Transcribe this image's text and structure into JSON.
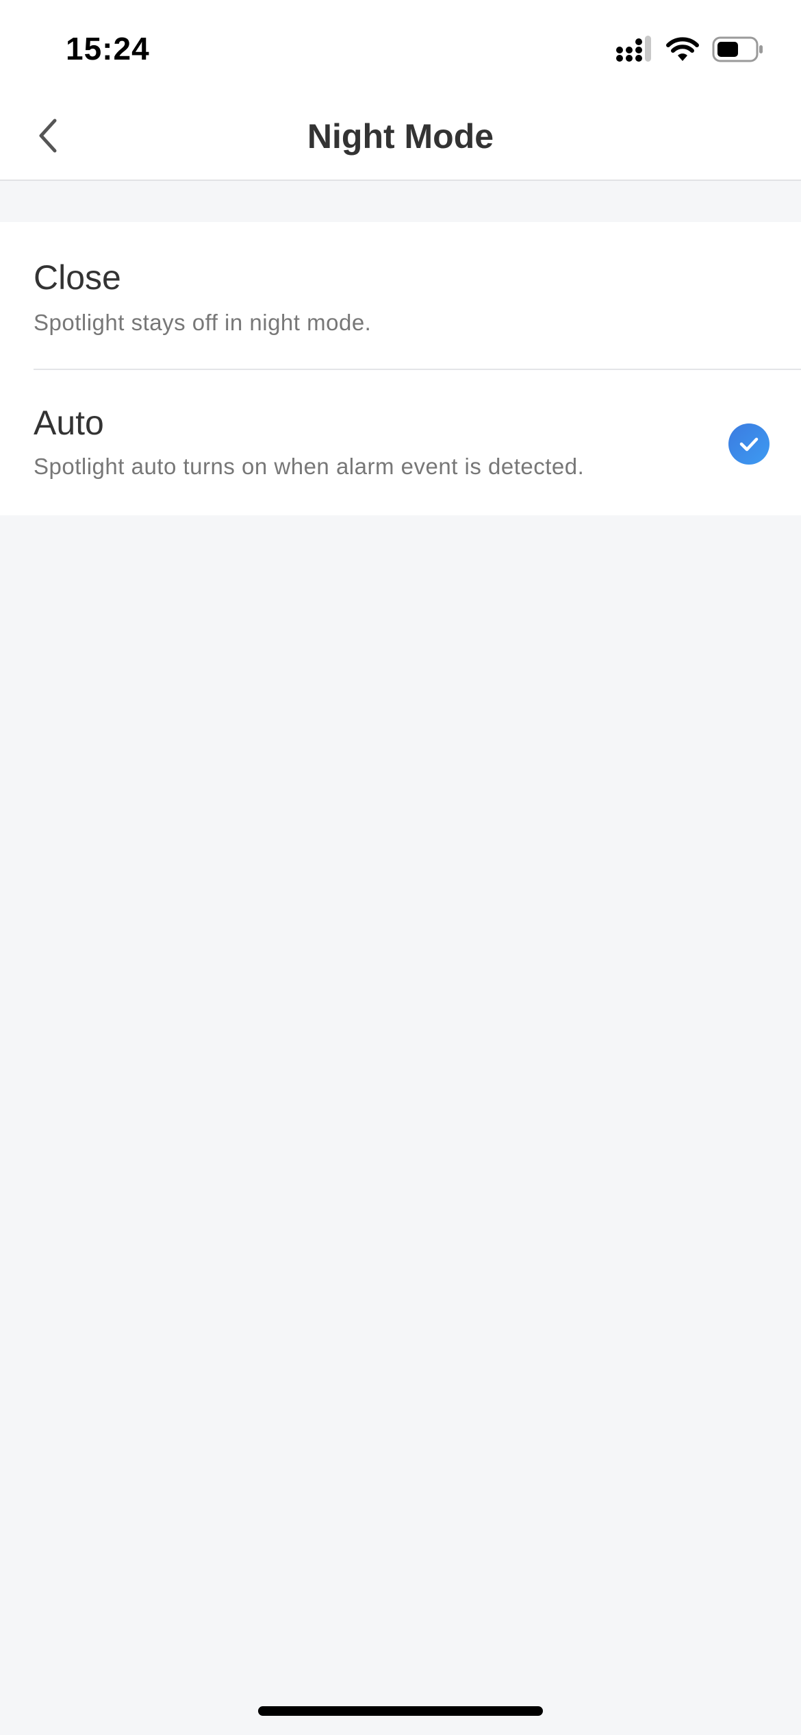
{
  "status_bar": {
    "time": "15:24"
  },
  "nav": {
    "title": "Night Mode"
  },
  "options": [
    {
      "title": "Close",
      "description": "Spotlight stays off in night mode.",
      "selected": false
    },
    {
      "title": "Auto",
      "description": "Spotlight auto turns on when alarm event is detected.",
      "selected": true
    }
  ],
  "icons": {
    "back": "chevron-left-icon",
    "selected": "check-circle-icon",
    "signal": "cellular-signal-icon",
    "wifi": "wifi-icon",
    "battery": "battery-icon"
  },
  "colors": {
    "accent": "#3B82E8",
    "background": "#F5F6F8",
    "surface": "#FFFFFF"
  }
}
